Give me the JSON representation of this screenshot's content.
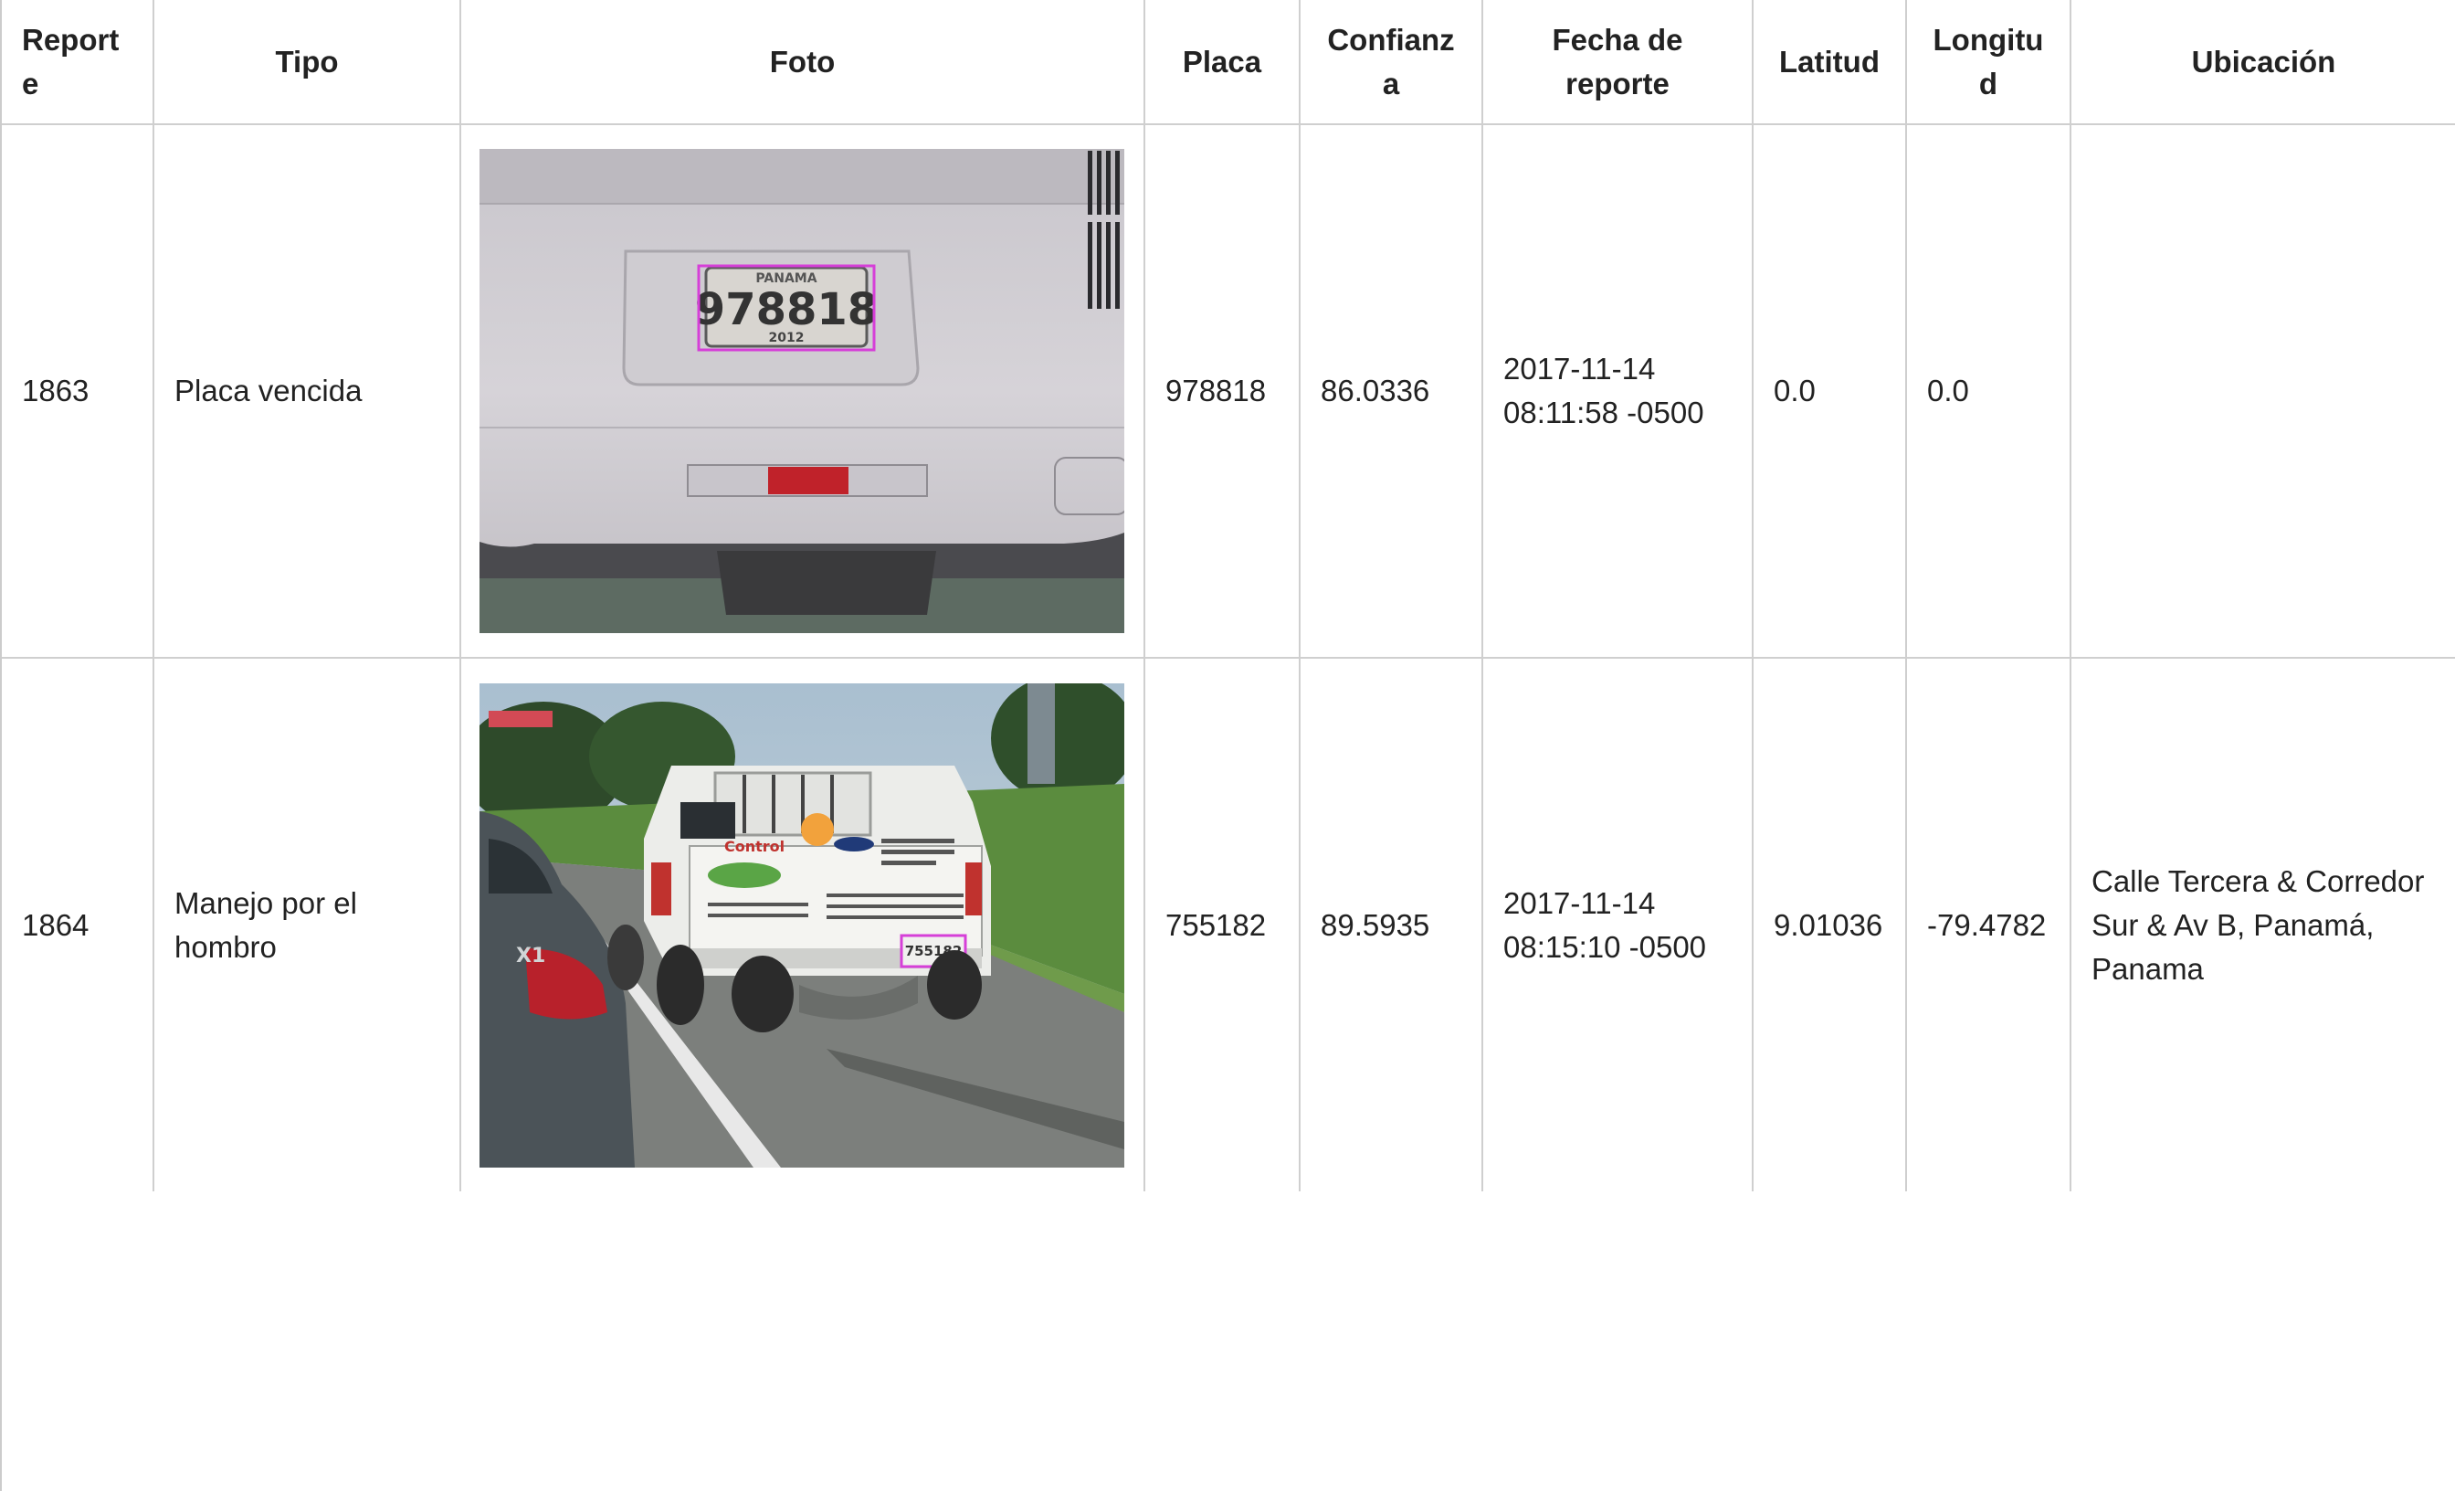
{
  "table": {
    "headers": [
      "Reporte",
      "Tipo",
      "Foto",
      "Placa",
      "Confianza",
      "Fecha de reporte",
      "Latitud",
      "Longitud",
      "Ubicación"
    ],
    "rows": [
      {
        "reporte": "1863",
        "tipo": "Placa vencida",
        "foto": {
          "plate_text": "978818",
          "plate_country": "PANAMA",
          "plate_year": "2012"
        },
        "placa": "978818",
        "confianza": "86.0336",
        "fecha_line1": "2017-11-14",
        "fecha_line2": "08:11:58 -0500",
        "latitud": "0.0",
        "longitud": "0.0",
        "ubicacion": ""
      },
      {
        "reporte": "1864",
        "tipo": "Manejo por el hombro",
        "foto": {
          "plate_text": "755182",
          "truck_brand": "Control",
          "suv_badge": "X1"
        },
        "placa": "755182",
        "confianza": "89.5935",
        "fecha_line1": "2017-11-14",
        "fecha_line2": "08:15:10 -0500",
        "latitud": "9.01036",
        "longitud": "-79.4782",
        "ubicacion": "Calle Tercera & Corredor Sur & Av B, Panamá, Panama"
      }
    ]
  },
  "colors": {
    "highlight_box": "#d63fd8",
    "grid_border": "#cfcfcf"
  }
}
